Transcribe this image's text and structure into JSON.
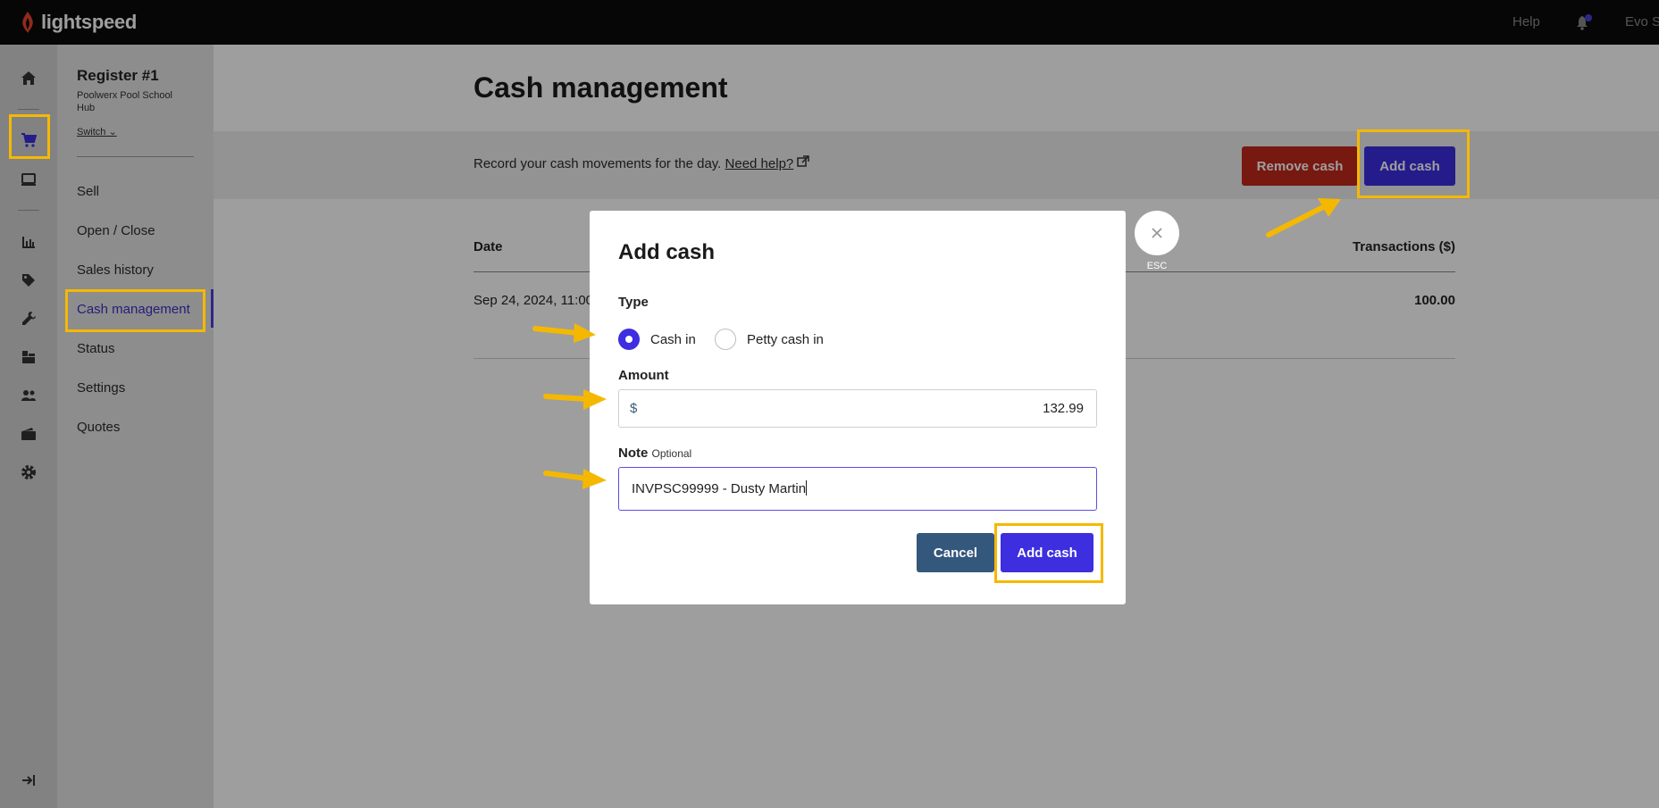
{
  "topbar": {
    "logo_text": "lightspeed",
    "help": "Help",
    "user": "Evo S"
  },
  "rail": {
    "icons": [
      "home-icon",
      "cart-icon",
      "register-icon",
      "reports-icon",
      "tag-icon",
      "wrench-icon",
      "inventory-icon",
      "customers-icon",
      "wallet-icon",
      "settings-icon",
      "collapse-icon"
    ]
  },
  "subnav": {
    "register_title": "Register #1",
    "register_location": "Poolwerx Pool School Hub",
    "switch_label": "Switch",
    "items": [
      {
        "label": "Sell"
      },
      {
        "label": "Open / Close"
      },
      {
        "label": "Sales history"
      },
      {
        "label": "Cash management"
      },
      {
        "label": "Status"
      },
      {
        "label": "Settings"
      },
      {
        "label": "Quotes"
      }
    ],
    "active_item": "Cash management"
  },
  "main": {
    "title": "Cash management",
    "band_text": "Record your cash movements for the day.",
    "help_link": "Need help?",
    "remove_cash_label": "Remove cash",
    "add_cash_label": "Add cash",
    "table": {
      "columns": [
        "Date",
        "Transactions ($)"
      ],
      "rows": [
        {
          "date": "Sep 24, 2024, 11:00",
          "amount": "100.00"
        }
      ]
    }
  },
  "modal": {
    "title": "Add cash",
    "type_label": "Type",
    "type_options": [
      {
        "label": "Cash in",
        "selected": true
      },
      {
        "label": "Petty cash in",
        "selected": false
      }
    ],
    "amount_label": "Amount",
    "currency_symbol": "$",
    "amount_value": "132.99",
    "note_label": "Note",
    "note_optional": "Optional",
    "note_value": "INVPSC99999 - Dusty Martin",
    "cancel_label": "Cancel",
    "submit_label": "Add cash",
    "close_hint": "ESC"
  },
  "colors": {
    "accent": "#3d2ee0",
    "danger": "#c0281c",
    "cancel": "#34577c",
    "annotation": "#f5b800",
    "logo": "#e8452c"
  }
}
